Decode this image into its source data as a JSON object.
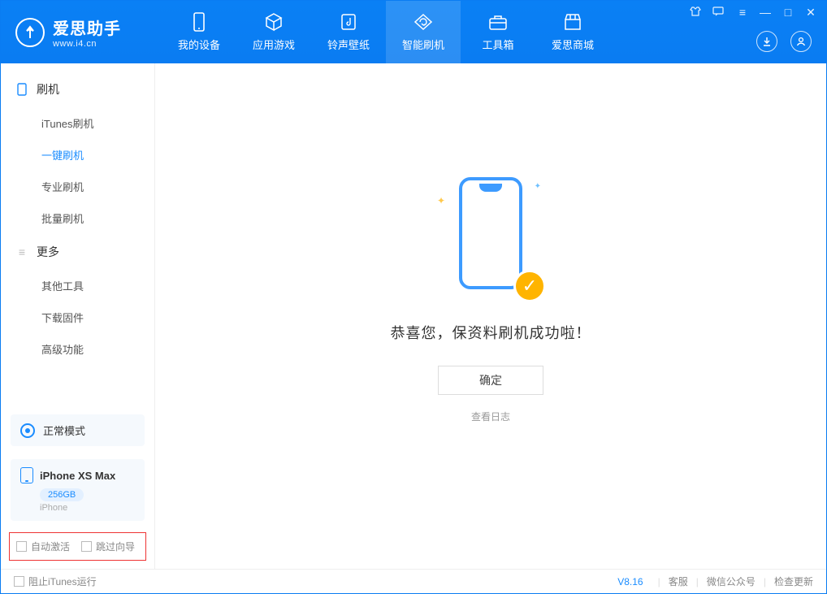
{
  "app": {
    "name": "爱思助手",
    "domain": "www.i4.cn"
  },
  "nav": [
    {
      "label": "我的设备",
      "icon": "device-icon"
    },
    {
      "label": "应用游戏",
      "icon": "cube-icon"
    },
    {
      "label": "铃声壁纸",
      "icon": "music-icon"
    },
    {
      "label": "智能刷机",
      "icon": "refresh-icon",
      "active": true
    },
    {
      "label": "工具箱",
      "icon": "toolbox-icon"
    },
    {
      "label": "爱思商城",
      "icon": "shop-icon"
    }
  ],
  "sidebar": {
    "section_flash": "刷机",
    "flash_items": [
      {
        "label": "iTunes刷机"
      },
      {
        "label": "一键刷机",
        "active": true
      },
      {
        "label": "专业刷机"
      },
      {
        "label": "批量刷机"
      }
    ],
    "section_more": "更多",
    "more_items": [
      {
        "label": "其他工具"
      },
      {
        "label": "下载固件"
      },
      {
        "label": "高级功能"
      }
    ],
    "mode_label": "正常模式",
    "device": {
      "name": "iPhone XS Max",
      "capacity": "256GB",
      "subtype": "iPhone"
    },
    "checkbox_auto_activate": "自动激活",
    "checkbox_skip_guide": "跳过向导"
  },
  "main": {
    "success_text": "恭喜您，保资料刷机成功啦！",
    "ok_button": "确定",
    "view_log": "查看日志"
  },
  "footer": {
    "block_itunes": "阻止iTunes运行",
    "version": "V8.16",
    "links": [
      "客服",
      "微信公众号",
      "检查更新"
    ]
  }
}
